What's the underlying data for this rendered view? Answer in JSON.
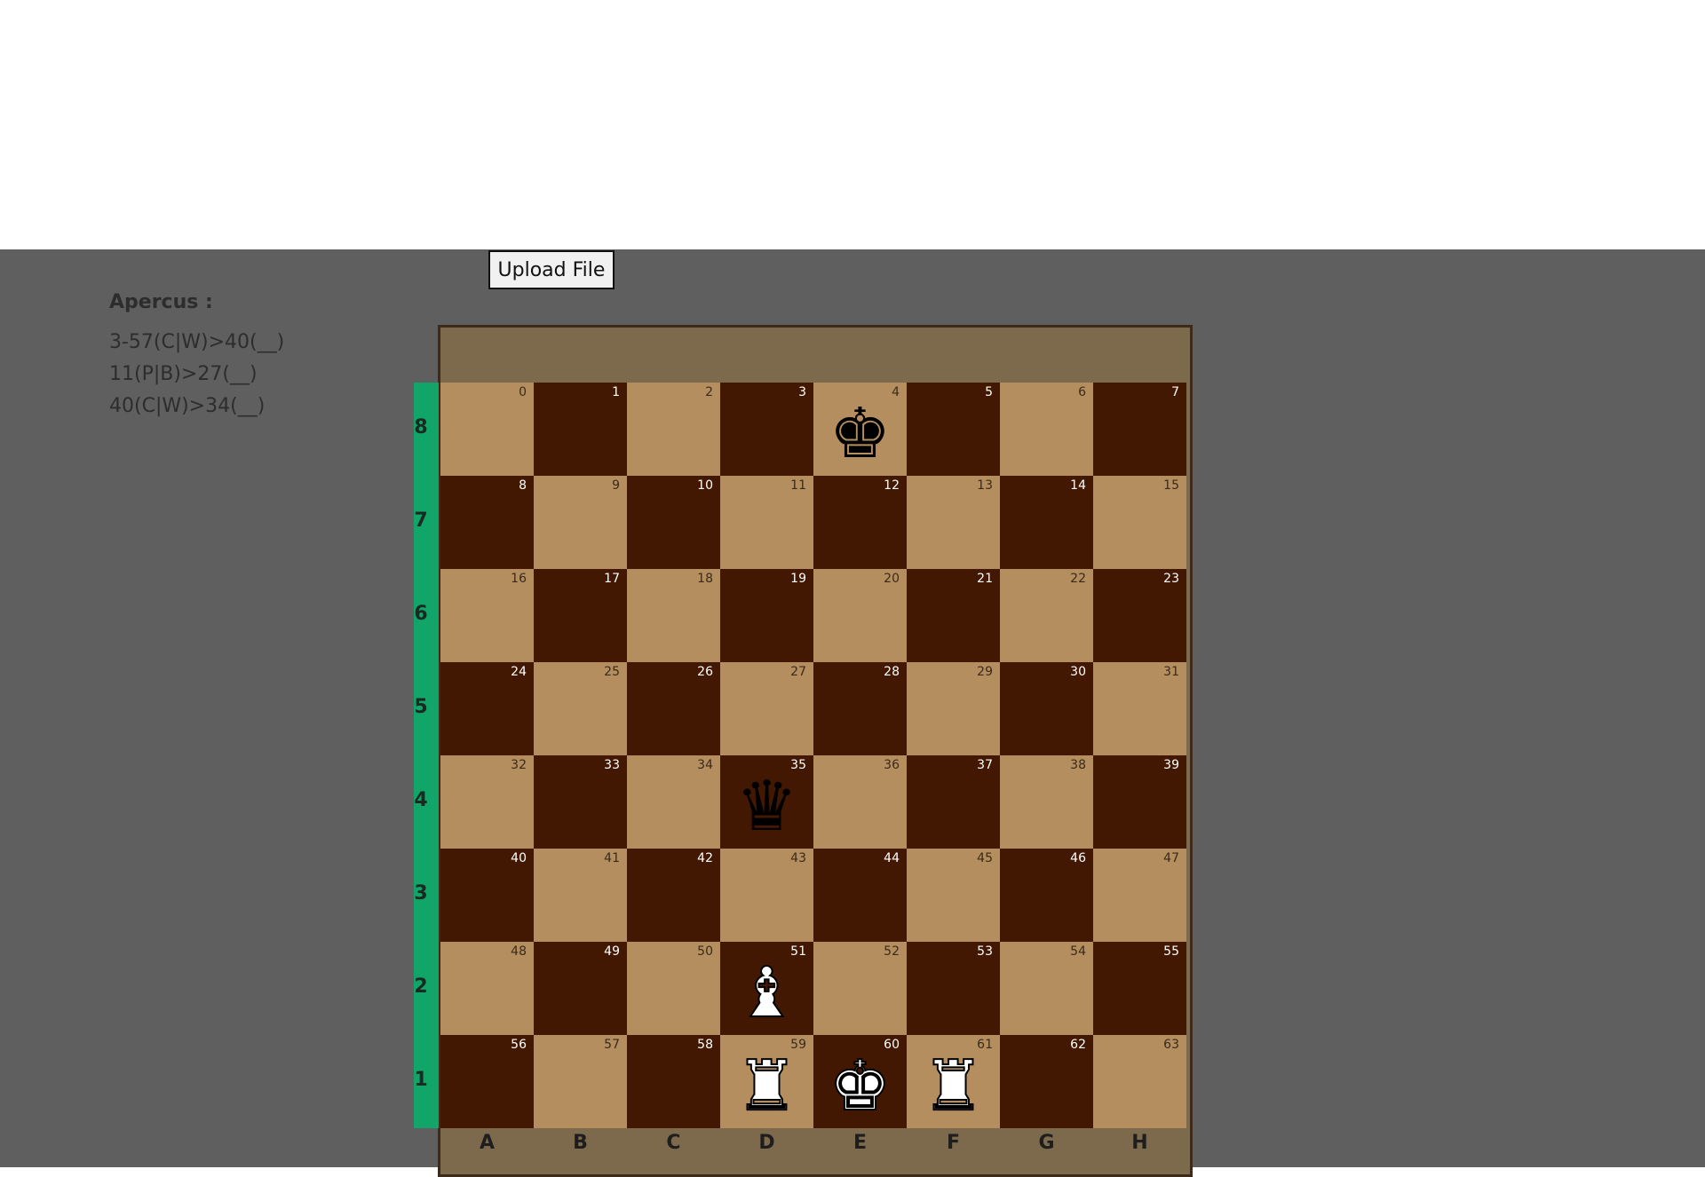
{
  "upload_button_label": "Upload File",
  "apercus": {
    "title": "Apercus :",
    "lines": [
      "3-57(C|W)>40(__)",
      "11(P|B)>27(__)",
      "40(C|W)>34(__)"
    ]
  },
  "board": {
    "ranks": [
      "8",
      "7",
      "6",
      "5",
      "4",
      "3",
      "2",
      "1"
    ],
    "files": [
      "A",
      "B",
      "C",
      "D",
      "E",
      "F",
      "G",
      "H"
    ],
    "colors": {
      "light": "#b48e5e",
      "dark": "#421802",
      "frame": "#7d6a4c",
      "rank_strip": "#12a56a"
    },
    "pieces": [
      {
        "square": 4,
        "piece": "king",
        "color": "black"
      },
      {
        "square": 35,
        "piece": "queen",
        "color": "black"
      },
      {
        "square": 51,
        "piece": "bishop",
        "color": "white"
      },
      {
        "square": 59,
        "piece": "rook",
        "color": "white"
      },
      {
        "square": 60,
        "piece": "king",
        "color": "white"
      },
      {
        "square": 61,
        "piece": "rook",
        "color": "white"
      }
    ]
  }
}
